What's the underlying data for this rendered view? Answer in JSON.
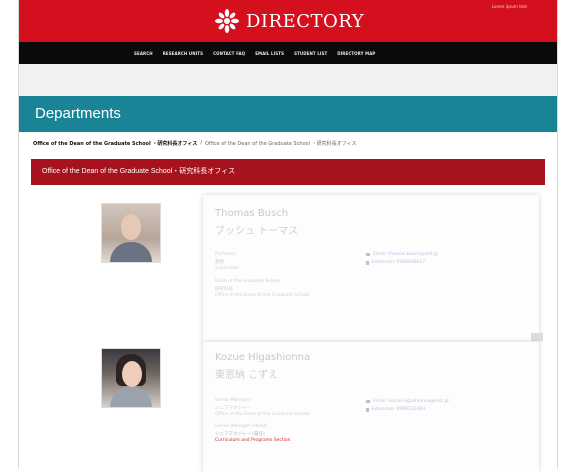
{
  "header": {
    "brand": "DIRECTORY",
    "top_tiny": "Lorem ipsum text"
  },
  "nav": {
    "items": [
      "SEARCH",
      "RESEARCH UNITS",
      "CONTACT FAQ",
      "EMAIL LISTS",
      "STUDENT LIST",
      "DIRECTORY MAP"
    ]
  },
  "departments": {
    "title": "Departments"
  },
  "breadcrumb": {
    "current": "Office of the Dean of the Graduate School ・研究科長オフィス",
    "separator": "/",
    "trail": "Office of the Dean of the Graduate School ・研究科長オフィス"
  },
  "office": {
    "title": "Office of the Dean of the Graduate School・研究科長オフィス"
  },
  "people": [
    {
      "name_en": "Thomas Busch",
      "name_jp": "ブッシュ トーマス",
      "lines": [
        "Professor",
        "教授",
        "Supervisor",
        "",
        "Dean of the Graduate School",
        "研究科長",
        "Office of the Dean of the Graduate School"
      ],
      "email": "Email: thomas.busch@oist.jp",
      "ext": "Extension: 0989008617"
    },
    {
      "name_en": "Kozue Higashionna",
      "name_jp": "東恩納 こずえ",
      "lines": [
        "Senior Manager",
        "シニアマネジャー",
        "Office of the Dean of the Graduate School",
        "",
        "Senior Manager (Head)",
        "シニアマネジャー (責任)"
      ],
      "link": "Curriculum and Programs Section",
      "email": "Email: kozue.higashionna@oist.jp",
      "ext": "Extension: 0989232469"
    }
  ],
  "colors": {
    "brand_red": "#d4101f",
    "nav_black": "#0a0a0a",
    "teal": "#1a8497",
    "office_red": "#a6121d"
  }
}
